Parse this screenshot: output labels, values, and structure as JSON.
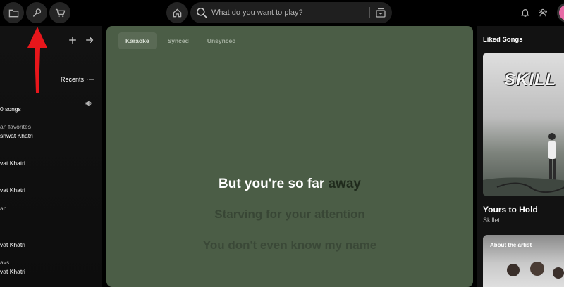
{
  "topbar": {
    "search_placeholder": "What do you want to play?"
  },
  "sidebar": {
    "recents_label": "Recents",
    "items": [
      {
        "label": "0 songs",
        "dim": false
      },
      {
        "label": "an favorites",
        "dim": true
      },
      {
        "label": "shwat Khatri",
        "dim": false
      },
      {
        "label": "vat Khatri",
        "dim": false
      },
      {
        "label": "vat Khatri",
        "dim": false
      },
      {
        "label": "an",
        "dim": true
      },
      {
        "label": "vat Khatri",
        "dim": false
      },
      {
        "label": "avs",
        "dim": true
      },
      {
        "label": "vat Khatri",
        "dim": false
      }
    ]
  },
  "lyrics": {
    "tabs": [
      "Karaoke",
      "Synced",
      "Unsynced"
    ],
    "active_tab": "Karaoke",
    "current_sung": "But you're so far",
    "current_unsung": "away",
    "next_1": "Starving for your attention",
    "next_2": "You don't even know my name"
  },
  "right_panel": {
    "title": "Liked Songs",
    "album_text": "SKILL",
    "song_title": "Yours to Hold",
    "artist": "Skillet",
    "about_label": "About the artist"
  },
  "colors": {
    "lyrics_bg": "#4b5d46",
    "annotation": "#e8161b",
    "avatar": "#e86aa6"
  },
  "icons": {
    "folder": "folder-icon",
    "wrench": "wrench-icon",
    "cart": "cart-icon",
    "home": "home-icon",
    "search": "search-icon",
    "browse": "browse-icon",
    "bell": "bell-icon",
    "friends": "friends-icon",
    "plus": "plus-icon",
    "arrow": "arrow-right-icon",
    "list": "list-icon",
    "speaker": "speaker-icon"
  }
}
